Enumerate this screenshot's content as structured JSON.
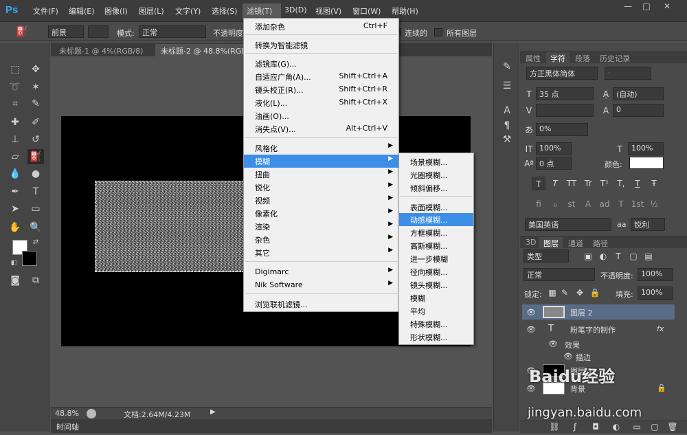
{
  "app": {
    "logo": "Ps"
  },
  "menubar": {
    "items": [
      "文件(F)",
      "编辑(E)",
      "图像(I)",
      "图层(L)",
      "文字(Y)",
      "选择(S)",
      "滤镜(T)",
      "3D(D)",
      "视图(V)",
      "窗口(W)",
      "帮助(H)"
    ],
    "window_controls": [
      "—",
      "□",
      "✕"
    ]
  },
  "options": {
    "preset": "前景",
    "mode_label": "模式:",
    "mode_value": "正常",
    "opacity_label": "不透明度",
    "contiguous": "连续的",
    "all_layers": "所有图层"
  },
  "doc_tabs": [
    "未标题-1 @ 4%(RGB/8)",
    "未标题-2 @ 48.8%(RGB/8)"
  ],
  "status": {
    "zoom": "48.8%",
    "doc_info": "文档:2.64M/4.23M",
    "timeline": "时间轴"
  },
  "filter_menu": {
    "items": [
      {
        "label": "添加杂色",
        "shortcut": "Ctrl+F"
      },
      {
        "label": "转换为智能滤镜",
        "shortcut": ""
      },
      {
        "label": "滤镜库(G)...",
        "shortcut": ""
      },
      {
        "label": "自适应广角(A)...",
        "shortcut": "Shift+Ctrl+A"
      },
      {
        "label": "镜头校正(R)...",
        "shortcut": "Shift+Ctrl+R"
      },
      {
        "label": "液化(L)...",
        "shortcut": "Shift+Ctrl+X"
      },
      {
        "label": "油画(O)...",
        "shortcut": ""
      },
      {
        "label": "消失点(V)...",
        "shortcut": "Alt+Ctrl+V"
      },
      {
        "label": "风格化",
        "shortcut": ""
      },
      {
        "label": "模糊",
        "shortcut": ""
      },
      {
        "label": "扭曲",
        "shortcut": ""
      },
      {
        "label": "锐化",
        "shortcut": ""
      },
      {
        "label": "视频",
        "shortcut": ""
      },
      {
        "label": "像素化",
        "shortcut": ""
      },
      {
        "label": "渲染",
        "shortcut": ""
      },
      {
        "label": "杂色",
        "shortcut": ""
      },
      {
        "label": "其它",
        "shortcut": ""
      },
      {
        "label": "Digimarc",
        "shortcut": ""
      },
      {
        "label": "Nik Software",
        "shortcut": ""
      },
      {
        "label": "浏览联机滤镜...",
        "shortcut": ""
      }
    ]
  },
  "blur_submenu": {
    "items": [
      "场景模糊...",
      "光圈模糊...",
      "倾斜偏移...",
      "表面模糊...",
      "动感模糊...",
      "方框模糊...",
      "高斯模糊...",
      "进一步模糊",
      "径向模糊...",
      "镜头模糊...",
      "模糊",
      "平均",
      "特殊模糊...",
      "形状模糊..."
    ]
  },
  "char_panel": {
    "tabs": [
      "属性",
      "字符",
      "段落",
      "历史记录"
    ],
    "font_family": "方正黑体简体",
    "font_style": "-",
    "size": "35 点",
    "leading": "(自动)",
    "kerning": "",
    "tracking": "0",
    "scale_v": "0%",
    "scale_h": "100%",
    "scale_h2": "100%",
    "baseline": "0 点",
    "color_label": "颜色:",
    "style_glyphs": [
      "T",
      "T",
      "TT",
      "Tr",
      "T¹",
      "T,",
      "T",
      "Ŧ"
    ],
    "ot_glyphs": [
      "fi",
      "ℴ",
      "st",
      "A",
      "ad",
      "T",
      "1st",
      "½"
    ],
    "language": "美国英语",
    "aa_label": "aa",
    "antialias": "锐利"
  },
  "layers_panel": {
    "tabs": [
      "3D",
      "图层",
      "通道",
      "路径"
    ],
    "filter": "类型",
    "blend": "正常",
    "opacity_label": "不透明度:",
    "opacity": "100%",
    "lock_label": "锁定:",
    "fill_label": "填充:",
    "fill": "100%",
    "layers": [
      {
        "name": "图层 2"
      },
      {
        "name": "粉笔字的制作",
        "fx": "fx"
      },
      {
        "name": "效果"
      },
      {
        "name": "描边"
      },
      {
        "name": "图层 1"
      },
      {
        "name": "背景"
      }
    ]
  },
  "watermark": {
    "brand": "Baidu经验",
    "url": "jingyan.baidu.com"
  }
}
